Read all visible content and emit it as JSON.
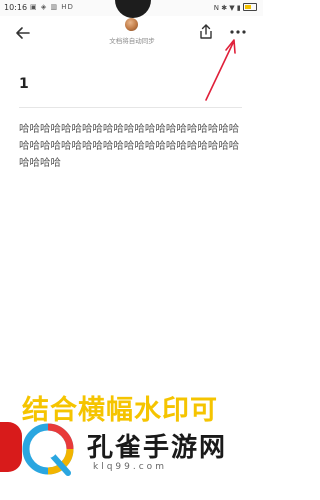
{
  "status_bar": {
    "time": "10:16",
    "left_icons": "▣ ◈ ▥ HD",
    "right_icons": "N ✱ ▼ ▮"
  },
  "app_bar": {
    "sync_status": "文档将自动同步"
  },
  "document": {
    "title": "1",
    "body": "哈哈哈哈哈哈哈哈哈哈哈哈哈哈哈哈哈哈哈哈哈哈哈哈哈哈哈哈哈哈哈哈哈哈哈哈哈哈哈哈哈哈哈哈哈哈"
  },
  "watermark": {
    "banner_text": "结合横幅水印可",
    "site_name": "孔雀手游网",
    "site_url": "klq99.com"
  },
  "colors": {
    "annotation": "#e0203a",
    "watermark_yellow": "#f5c400",
    "watermark_red": "#d81b1b"
  }
}
